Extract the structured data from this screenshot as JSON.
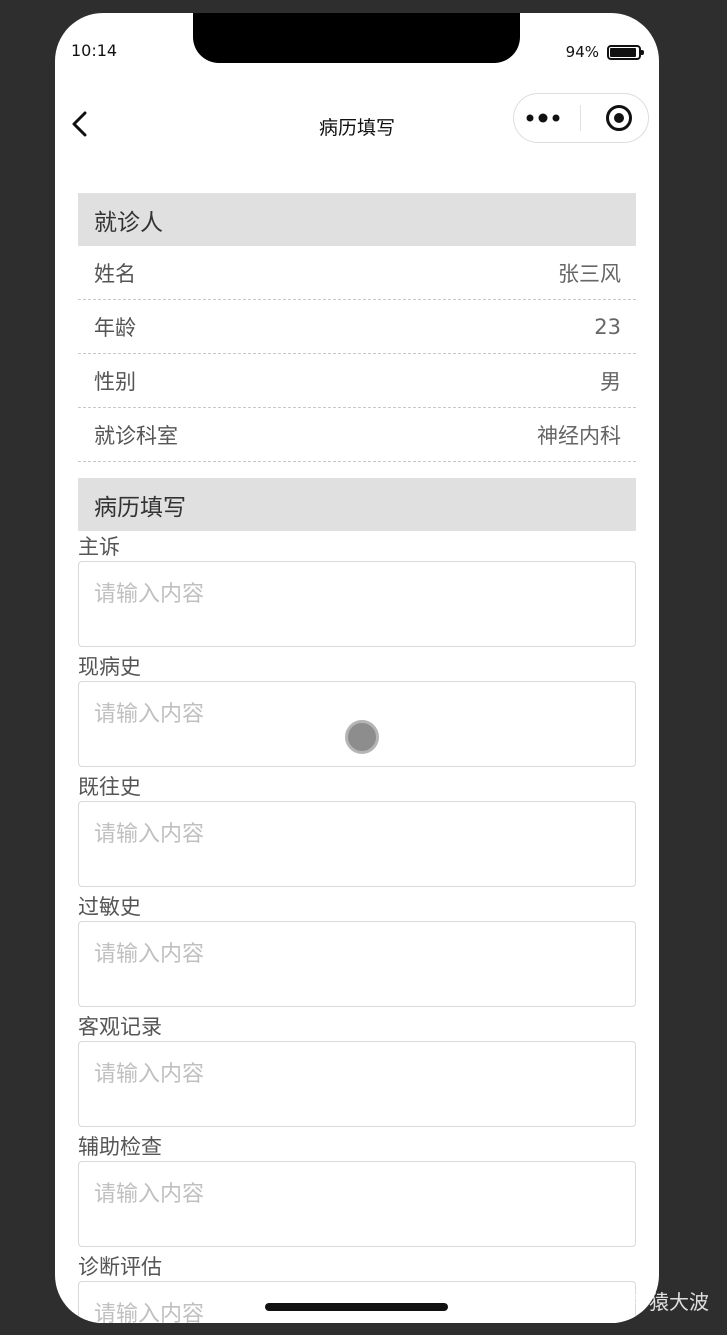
{
  "status_bar": {
    "time": "10:14",
    "battery_percent": "94%",
    "battery_level": 0.94
  },
  "nav": {
    "title": "病历填写",
    "back_icon": "chevron-left-icon",
    "more_icon": "more-dots-icon",
    "target_icon": "target-icon"
  },
  "patient_section": {
    "title": "就诊人",
    "rows": [
      {
        "label": "姓名",
        "value": "张三风"
      },
      {
        "label": "年龄",
        "value": "23"
      },
      {
        "label": "性别",
        "value": "男"
      },
      {
        "label": "就诊科室",
        "value": "神经内科"
      }
    ]
  },
  "record_section": {
    "title": "病历填写",
    "fields": [
      {
        "label": "主诉",
        "placeholder": "请输入内容"
      },
      {
        "label": "现病史",
        "placeholder": "请输入内容"
      },
      {
        "label": "既往史",
        "placeholder": "请输入内容"
      },
      {
        "label": "过敏史",
        "placeholder": "请输入内容"
      },
      {
        "label": "客观记录",
        "placeholder": "请输入内容"
      },
      {
        "label": "辅助检查",
        "placeholder": "请输入内容"
      },
      {
        "label": "诊断评估",
        "placeholder": "请输入内容"
      }
    ]
  },
  "watermark": "知乎 @程序猿大波"
}
